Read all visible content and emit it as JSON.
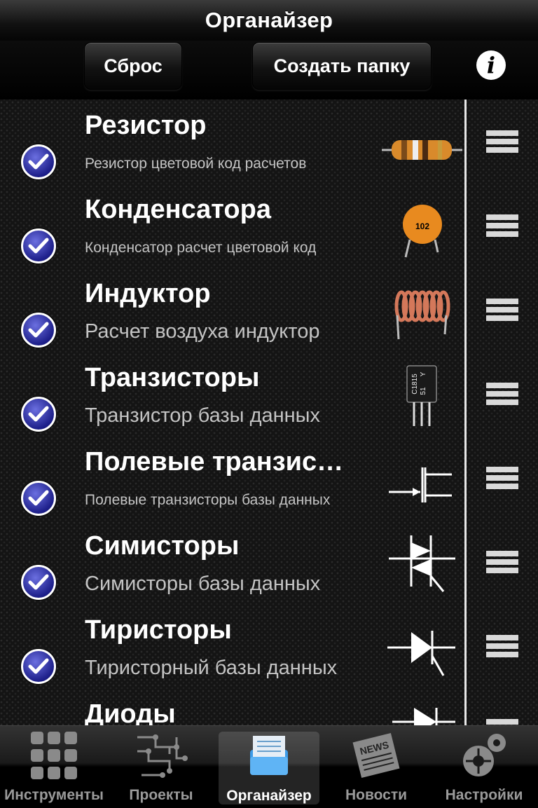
{
  "header": {
    "title": "Органайзер"
  },
  "toolbar": {
    "reset_label": "Сброс",
    "create_folder_label": "Создать папку",
    "info_icon": "info-icon"
  },
  "items": [
    {
      "title": "Резистор",
      "subtitle": "Резистор цветовой код расчетов",
      "checked": true
    },
    {
      "title": "Конденсатора",
      "subtitle": "Конденсатор расчет цветовой код",
      "checked": true,
      "badge": "102"
    },
    {
      "title": "Индуктор",
      "subtitle": "Расчет воздуха индуктор",
      "checked": true
    },
    {
      "title": "Транзисторы",
      "subtitle": "Транзистор базы данных",
      "checked": true,
      "marking": [
        "C1815",
        "Y",
        "51"
      ]
    },
    {
      "title": "Полевые транзис…",
      "subtitle": "Полевые транзисторы базы данных",
      "checked": true
    },
    {
      "title": "Симисторы",
      "subtitle": "Симисторы базы данных",
      "checked": true
    },
    {
      "title": "Тиристоры",
      "subtitle": "Тиристорный базы данных",
      "checked": true
    },
    {
      "title": "Диоды",
      "subtitle": "",
      "checked": true
    }
  ],
  "tabs": [
    {
      "label": "Инструменты",
      "icon": "grid-icon"
    },
    {
      "label": "Проекты",
      "icon": "circuit-icon"
    },
    {
      "label": "Органайзер",
      "icon": "organizer-tray-icon",
      "active": true
    },
    {
      "label": "Новости",
      "icon": "newspaper-icon",
      "badge": "NEWS"
    },
    {
      "label": "Настройки",
      "icon": "gears-icon"
    }
  ],
  "colors": {
    "check_blue": "#2a2da8",
    "text_secondary": "#c4c4c4",
    "tab_active": "#ffffff",
    "tab_inactive": "#9a9a9a"
  }
}
